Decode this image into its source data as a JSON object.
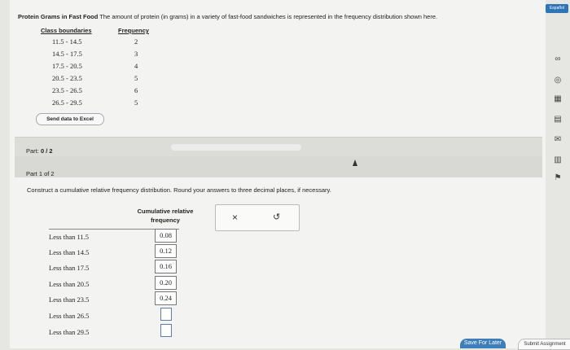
{
  "language_button": "Español",
  "problem": {
    "title": "Protein Grams in Fast Food",
    "text": " The amount of protein (in grams) in a variety of fast-food sandwiches is represented in the frequency distribution shown here."
  },
  "freq_table": {
    "headers": [
      "Class boundaries",
      "Frequency"
    ],
    "rows": [
      {
        "class": "11.5 - 14.5",
        "freq": "2"
      },
      {
        "class": "14.5 - 17.5",
        "freq": "3"
      },
      {
        "class": "17.5 - 20.5",
        "freq": "4"
      },
      {
        "class": "20.5 - 23.5",
        "freq": "5"
      },
      {
        "class": "23.5 - 26.5",
        "freq": "6"
      },
      {
        "class": "26.5 - 29.5",
        "freq": "5"
      }
    ]
  },
  "excel_button": "Send data to Excel",
  "part_progress": {
    "prefix": "Part:",
    "value": "0 / 2",
    "fraction": 0.0
  },
  "part1_label": "Part 1 of 2",
  "instruction": "Construct a cumulative relative frequency distribution. Round your answers to three decimal places, if necessary.",
  "cum_table": {
    "header_line1": "Cumulative relative",
    "header_line2": "frequency",
    "rows": [
      {
        "label": "Less than 11.5",
        "value": "0.08"
      },
      {
        "label": "Less than 14.5",
        "value": "0.12"
      },
      {
        "label": "Less than 17.5",
        "value": "0.16"
      },
      {
        "label": "Less than 20.5",
        "value": "0.20"
      },
      {
        "label": "Less than 23.5",
        "value": "0.24"
      },
      {
        "label": "Less than 26.5",
        "value": ""
      },
      {
        "label": "Less than 29.5",
        "value": ""
      }
    ]
  },
  "tools": {
    "clear": "×",
    "undo": "↺"
  },
  "side_icons": [
    "infinity-icon",
    "target-icon",
    "calculator-icon",
    "book-icon",
    "mail-icon",
    "chart-icon",
    "flag-icon"
  ],
  "save_button": "Save For Later",
  "submit_button": "Submit Assignment"
}
